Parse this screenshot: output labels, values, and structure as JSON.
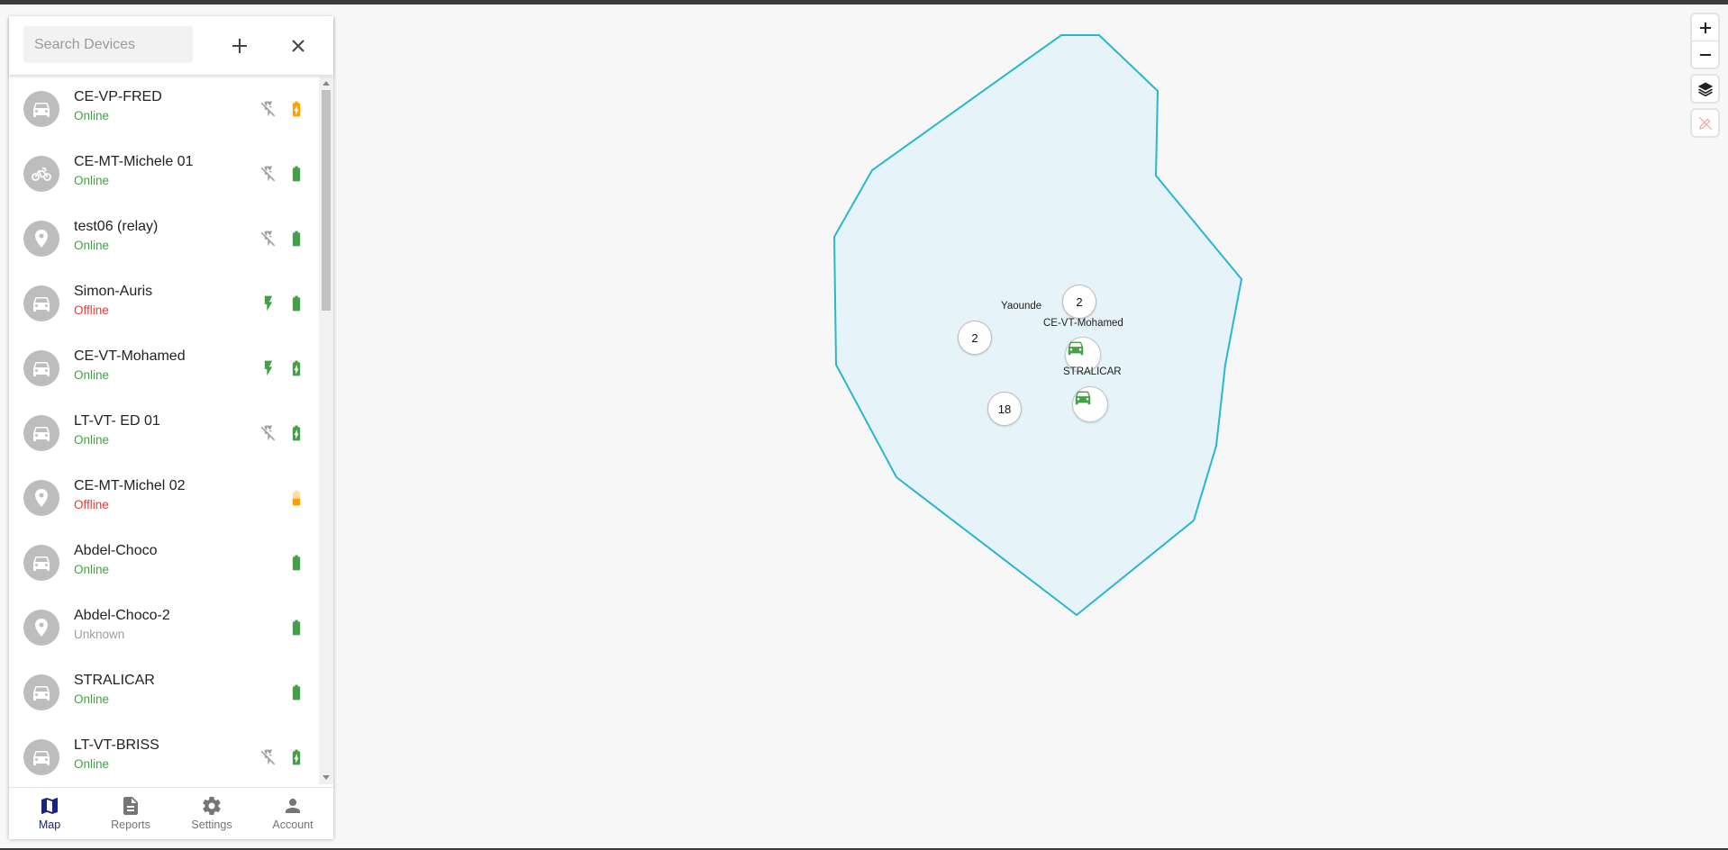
{
  "search": {
    "placeholder": "Search Devices"
  },
  "devices": [
    {
      "name": "CE-VP-FRED",
      "status": "Online",
      "status_class": "online",
      "avatar_icon": "car-icon",
      "ignition": "off",
      "battery": "charging-orange"
    },
    {
      "name": "CE-MT-Michele 01",
      "status": "Online",
      "status_class": "online",
      "avatar_icon": "motorcycle-icon",
      "ignition": "off",
      "battery": "full"
    },
    {
      "name": "test06 (relay)",
      "status": "Online",
      "status_class": "online",
      "avatar_icon": "location-pin-icon",
      "ignition": "off",
      "battery": "full"
    },
    {
      "name": "Simon-Auris",
      "status": "Offline",
      "status_class": "offline",
      "avatar_icon": "car-icon",
      "ignition": "on",
      "battery": "full"
    },
    {
      "name": "CE-VT-Mohamed",
      "status": "Online",
      "status_class": "online",
      "avatar_icon": "car-icon",
      "ignition": "on",
      "battery": "charging"
    },
    {
      "name": "LT-VT- ED 01",
      "status": "Online",
      "status_class": "online",
      "avatar_icon": "car-icon",
      "ignition": "off",
      "battery": "charging"
    },
    {
      "name": "CE-MT-Michel 02",
      "status": "Offline",
      "status_class": "offline",
      "avatar_icon": "location-pin-icon",
      "ignition": "none",
      "battery": "low-orange"
    },
    {
      "name": "Abdel-Choco",
      "status": "Online",
      "status_class": "online",
      "avatar_icon": "car-icon",
      "ignition": "none",
      "battery": "full"
    },
    {
      "name": "Abdel-Choco-2",
      "status": "Unknown",
      "status_class": "unknown",
      "avatar_icon": "location-pin-icon",
      "ignition": "none",
      "battery": "full"
    },
    {
      "name": "STRALICAR",
      "status": "Online",
      "status_class": "online",
      "avatar_icon": "car-icon",
      "ignition": "none",
      "battery": "full"
    },
    {
      "name": "LT-VT-BRISS",
      "status": "Online",
      "status_class": "online",
      "avatar_icon": "car-icon",
      "ignition": "off",
      "battery": "charging"
    }
  ],
  "nav": [
    {
      "label": "Map",
      "icon": "map-icon",
      "active": true
    },
    {
      "label": "Reports",
      "icon": "document-icon",
      "active": false
    },
    {
      "label": "Settings",
      "icon": "gear-icon",
      "active": false
    },
    {
      "label": "Account",
      "icon": "person-icon",
      "active": false
    }
  ],
  "map": {
    "geofence_color": "#29b6d0",
    "geofence_fill": "#e6f3f8",
    "labels": {
      "city": "Yaounde",
      "device_1": "CE-VT-Mohamed",
      "device_2": "STRALICAR"
    },
    "clusters": {
      "a": "2",
      "b": "2",
      "c": "18"
    }
  },
  "colors": {
    "online": "#43a047",
    "offline": "#e53935",
    "unknown": "#9e9e9e",
    "accent": "#1a237e",
    "charging_orange": "#ffa000"
  }
}
